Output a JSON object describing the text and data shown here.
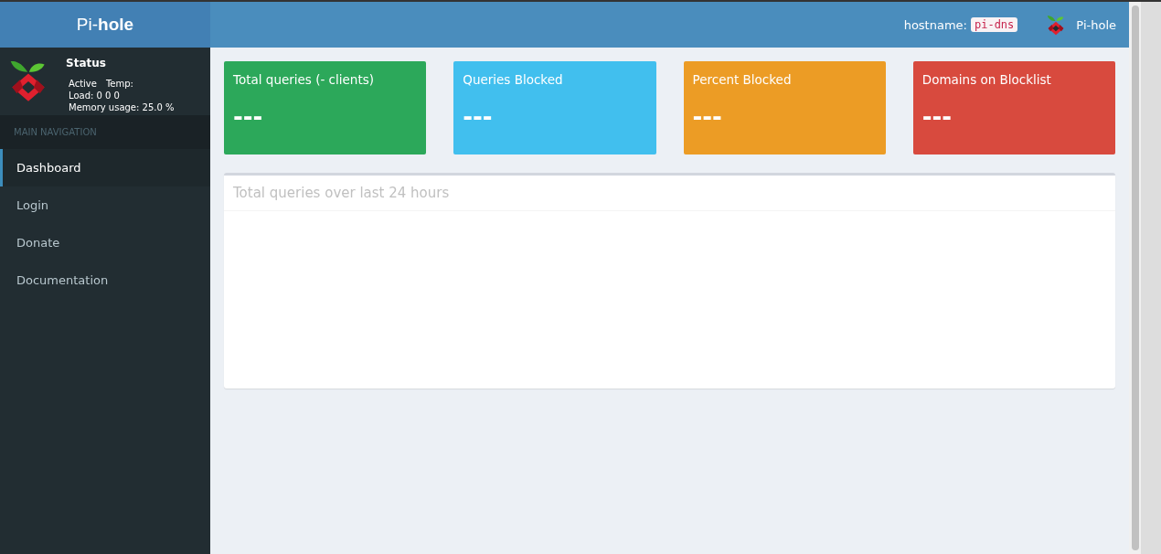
{
  "header": {
    "logo_light": "Pi-",
    "logo_bold": "hole",
    "hostname_label": "hostname:",
    "hostname": "pi-dns",
    "user": "Pi-hole"
  },
  "status": {
    "title": "Status",
    "active": "Active",
    "temp": "Temp:",
    "load": "Load:  0  0  0",
    "memory": "Memory usage:  25.0 %"
  },
  "sidebar": {
    "heading": "MAIN NAVIGATION",
    "items": [
      {
        "label": "Dashboard",
        "selected": true
      },
      {
        "label": "Login",
        "selected": false
      },
      {
        "label": "Donate",
        "selected": false
      },
      {
        "label": "Documentation",
        "selected": false
      }
    ]
  },
  "stats": [
    {
      "title": "Total queries (- clients)",
      "value": "---",
      "color": "#2ca85a"
    },
    {
      "title": "Queries Blocked",
      "value": "---",
      "color": "#41bfee"
    },
    {
      "title": "Percent Blocked",
      "value": "---",
      "color": "#ec9c25"
    },
    {
      "title": "Domains on Blocklist",
      "value": "---",
      "color": "#d84a3e"
    }
  ],
  "chart_panel": {
    "title": "Total queries over last 24 hours"
  }
}
